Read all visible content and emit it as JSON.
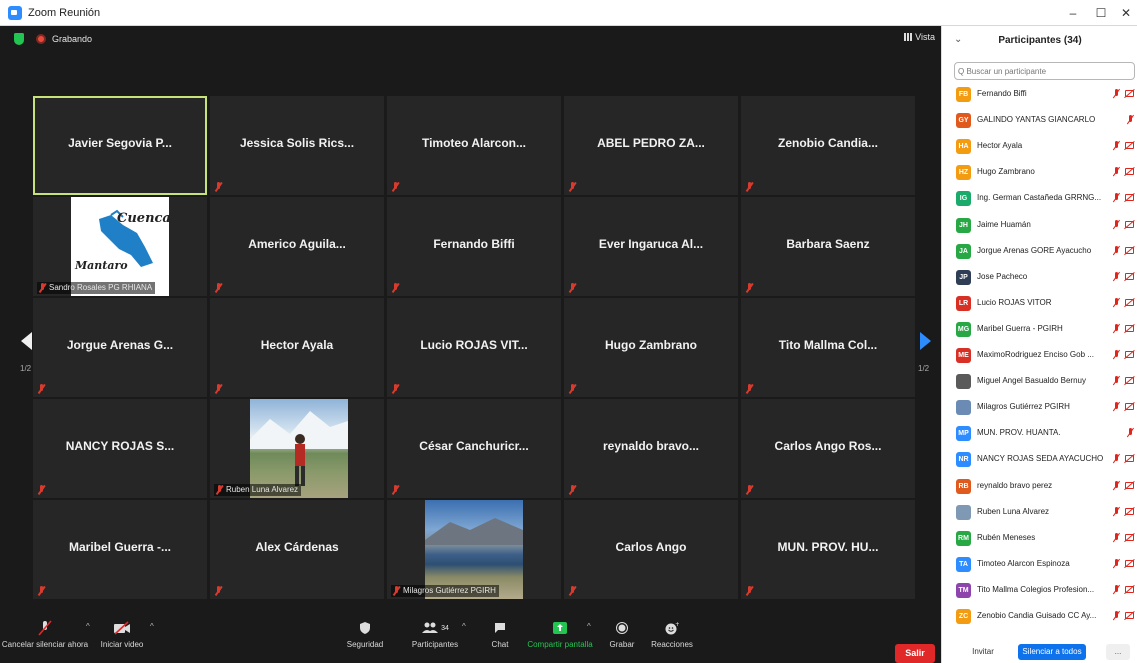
{
  "window": {
    "title": "Zoom Reunión",
    "minimize": "–",
    "maximize": "☐",
    "close": "✕"
  },
  "meeting": {
    "recording_label": "Grabando",
    "view_label": "Vista",
    "page_indicator": "1/2",
    "tiles": [
      {
        "name": "Javier Segovia P...",
        "active": true,
        "muted": false
      },
      {
        "name": "Jessica Solis Rics...",
        "muted": true
      },
      {
        "name": "Timoteo Alarcon...",
        "muted": true
      },
      {
        "name": "ABEL PEDRO ZA...",
        "muted": true
      },
      {
        "name": "Zenobio Candia...",
        "muted": true
      },
      {
        "name": "",
        "caption": "Sandro Rosales PG RHIANA",
        "picture": "cuenca-mantaro-logo",
        "logo_text_top": "Cuenca",
        "logo_text_bottom": "Mantaro"
      },
      {
        "name": "Americo Aguila...",
        "muted": true
      },
      {
        "name": "Fernando Biffi",
        "muted": true
      },
      {
        "name": "Ever Ingaruca Al...",
        "muted": true
      },
      {
        "name": "Barbara Saenz",
        "muted": true
      },
      {
        "name": "Jorgue Arenas G...",
        "muted": true
      },
      {
        "name": "Hector Ayala",
        "muted": true
      },
      {
        "name": "Lucio ROJAS VIT...",
        "muted": true
      },
      {
        "name": "Hugo Zambrano",
        "muted": true
      },
      {
        "name": "Tito Mallma Col...",
        "muted": true
      },
      {
        "name": "NANCY ROJAS S...",
        "muted": true
      },
      {
        "name": "",
        "caption": "Ruben Luna Alvarez",
        "picture": "mountain-photo"
      },
      {
        "name": "César Canchuricr...",
        "muted": true
      },
      {
        "name": "reynaldo bravo...",
        "muted": true
      },
      {
        "name": "Carlos Ango Ros...",
        "muted": true
      },
      {
        "name": "Maribel Guerra -...",
        "muted": true
      },
      {
        "name": "Alex Cárdenas",
        "muted": true
      },
      {
        "name": "",
        "caption": "Milagros Gutiérrez PGIRH",
        "picture": "lake-photo"
      },
      {
        "name": "Carlos Ango",
        "muted": true
      },
      {
        "name": "MUN. PROV. HU...",
        "muted": true
      }
    ]
  },
  "toolbar": {
    "unmute": "Cancelar silenciar ahora",
    "video": "Iniciar video",
    "security": "Seguridad",
    "participants": "Participantes",
    "participants_count": "34",
    "chat": "Chat",
    "share": "Compartir pantalla",
    "record": "Grabar",
    "reactions": "Reacciones",
    "leave": "Salir"
  },
  "panel": {
    "title": "Participantes (34)",
    "search_placeholder": "Q Buscar un participante",
    "invite": "Invitar",
    "mute_all": "Silenciar a todos",
    "more": "...",
    "participants": [
      {
        "initials": "FB",
        "name": "Fernando Biffi",
        "color": "#f39c12",
        "cam": true
      },
      {
        "initials": "GY",
        "name": "GALINDO YANTAS GIANCARLO",
        "color": "#e05a1e",
        "cam": false
      },
      {
        "initials": "HA",
        "name": "Hector Ayala",
        "color": "#f39c12",
        "cam": true
      },
      {
        "initials": "HZ",
        "name": "Hugo Zambrano",
        "color": "#f39c12",
        "cam": true
      },
      {
        "initials": "IG",
        "name": "Ing. German Castañeda GRRNG...",
        "color": "#1aab6b",
        "cam": true
      },
      {
        "initials": "JH",
        "name": "Jaime Huamán",
        "color": "#27a844",
        "cam": true
      },
      {
        "initials": "JA",
        "name": "Jorgue Arenas GORE Ayacucho",
        "color": "#27a844",
        "cam": true
      },
      {
        "initials": "JP",
        "name": "Jose Pacheco",
        "color": "#2e3e55",
        "cam": true
      },
      {
        "initials": "LR",
        "name": "Lucio ROJAS VITOR",
        "color": "#d93025",
        "cam": true
      },
      {
        "initials": "MG",
        "name": "Maribel Guerra - PGIRH",
        "color": "#27a844",
        "cam": true
      },
      {
        "initials": "ME",
        "name": "MaximoRodriguez Enciso Gob ...",
        "color": "#d93025",
        "cam": true
      },
      {
        "initials": "",
        "name": "Miguel Angel Basualdo Bernuy",
        "color": "#5a5a5a",
        "cam": true,
        "photo": true
      },
      {
        "initials": "",
        "name": "Milagros Gutiérrez PGIRH",
        "color": "#6b8bb5",
        "cam": true,
        "photo": true
      },
      {
        "initials": "MP",
        "name": "MUN. PROV. HUANTA.",
        "color": "#2d8cff",
        "cam": false
      },
      {
        "initials": "NR",
        "name": "NANCY ROJAS SEDA AYACUCHO",
        "color": "#2d8cff",
        "cam": true
      },
      {
        "initials": "RB",
        "name": "reynaldo bravo perez",
        "color": "#e05a1e",
        "cam": true
      },
      {
        "initials": "",
        "name": "Ruben Luna Alvarez",
        "color": "#7f98b3",
        "cam": true,
        "photo": true
      },
      {
        "initials": "RM",
        "name": "Rubén Meneses",
        "color": "#27a844",
        "cam": true
      },
      {
        "initials": "TA",
        "name": "Timoteo Alarcon Espinoza",
        "color": "#2d8cff",
        "cam": true
      },
      {
        "initials": "TM",
        "name": "Tito Mallma Colegios Profesion...",
        "color": "#8e44ad",
        "cam": true
      },
      {
        "initials": "ZC",
        "name": "Zenobio Candia Guisado CC Ay...",
        "color": "#f39c12",
        "cam": true
      }
    ]
  }
}
